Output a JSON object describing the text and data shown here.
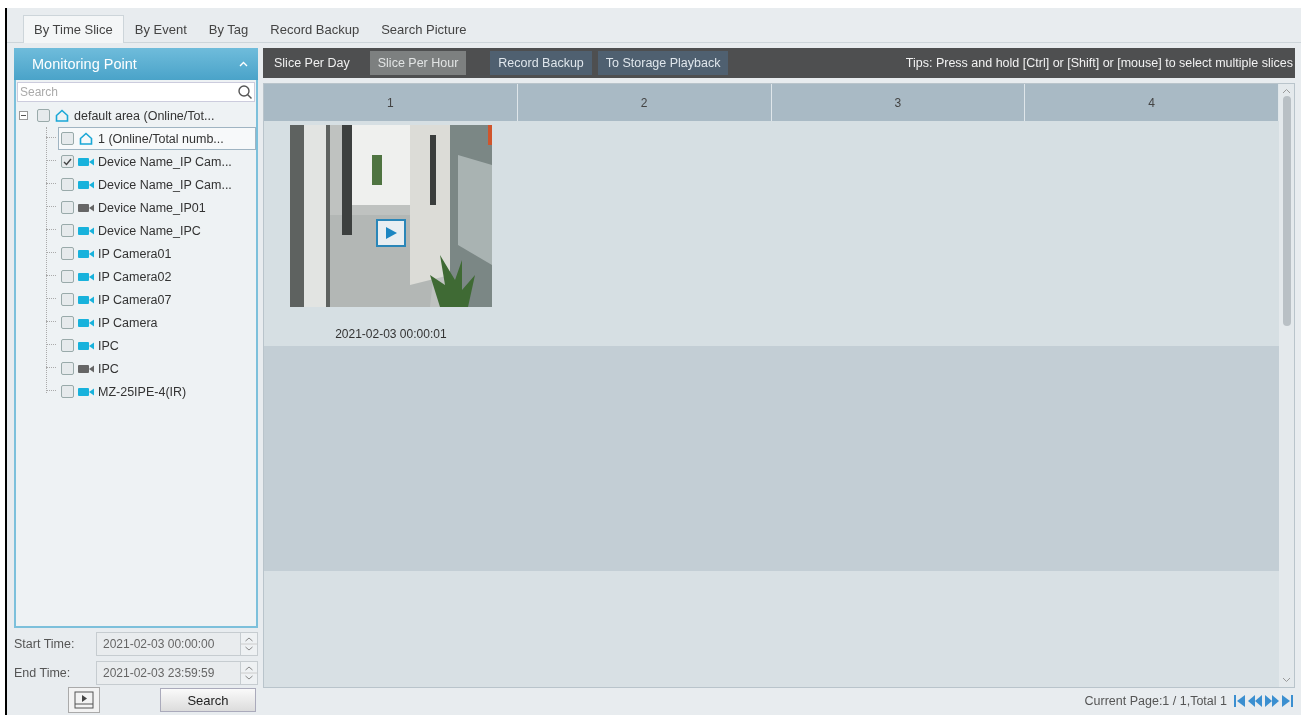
{
  "tabs": [
    {
      "label": "By Time Slice",
      "selected": true
    },
    {
      "label": "By Event",
      "selected": false
    },
    {
      "label": "By Tag",
      "selected": false
    },
    {
      "label": "Record Backup",
      "selected": false
    },
    {
      "label": "Search Picture",
      "selected": false
    }
  ],
  "sidebar": {
    "title": "Monitoring Point",
    "search": {
      "placeholder": "Search"
    },
    "tree": [
      {
        "label": "default area (Online/Tot...",
        "kind": "area",
        "checked": false,
        "selected": false,
        "expanded": true,
        "children": [
          {
            "label": "1 (Online/Total numb...",
            "kind": "area",
            "checked": false,
            "selected": true
          },
          {
            "label": "Device Name_IP Cam...",
            "kind": "camera",
            "online": true,
            "checked": true,
            "selected": false
          },
          {
            "label": "Device Name_IP Cam...",
            "kind": "camera",
            "online": true,
            "checked": false,
            "selected": false
          },
          {
            "label": "Device Name_IP01",
            "kind": "camera",
            "online": false,
            "checked": false,
            "selected": false
          },
          {
            "label": "Device Name_IPC",
            "kind": "camera",
            "online": true,
            "checked": false,
            "selected": false
          },
          {
            "label": "IP Camera01",
            "kind": "camera",
            "online": true,
            "checked": false,
            "selected": false
          },
          {
            "label": "IP Camera02",
            "kind": "camera",
            "online": true,
            "checked": false,
            "selected": false
          },
          {
            "label": "IP Camera07",
            "kind": "camera",
            "online": true,
            "checked": false,
            "selected": false
          },
          {
            "label": "IP Camera",
            "kind": "camera",
            "online": true,
            "checked": false,
            "selected": false
          },
          {
            "label": "IPC",
            "kind": "camera",
            "online": true,
            "checked": false,
            "selected": false
          },
          {
            "label": "IPC",
            "kind": "camera",
            "online": false,
            "checked": false,
            "selected": false
          },
          {
            "label": "MZ-25IPE-4(IR)",
            "kind": "camera",
            "online": true,
            "checked": false,
            "selected": false
          }
        ]
      }
    ],
    "start_time": {
      "label": "Start Time:",
      "value": "2021-02-03 00:00:00"
    },
    "end_time": {
      "label": "End Time:",
      "value": "2021-02-03 23:59:59"
    },
    "search_button": "Search"
  },
  "toolbar": {
    "buttons": [
      {
        "label": "Slice Per Day",
        "kind": "mode",
        "disabled": false
      },
      {
        "label": "Slice Per Hour",
        "kind": "mode",
        "disabled": true
      },
      {
        "label": "Record Backup",
        "kind": "action",
        "disabled": false
      },
      {
        "label": "To Storage Playback",
        "kind": "action",
        "disabled": false
      }
    ],
    "tips": "Tips: Press and hold [Ctrl] or [Shift] or [mouse] to select multiple slices"
  },
  "grid": {
    "columns": [
      "1",
      "2",
      "3",
      "4"
    ],
    "slices": [
      {
        "time": "2021-02-03 00:00:01",
        "kind": "picture"
      }
    ]
  },
  "pagination": {
    "text": "Current Page:1 / 1,Total 1"
  }
}
